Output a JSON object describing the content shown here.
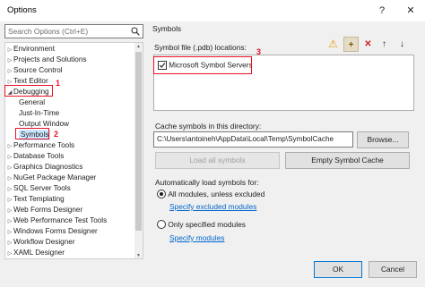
{
  "window": {
    "title": "Options",
    "help_glyph": "?",
    "close_glyph": "✕"
  },
  "search": {
    "placeholder": "Search Options (Ctrl+E)"
  },
  "tree": {
    "items": [
      {
        "label": "Environment",
        "expander": "▷"
      },
      {
        "label": "Projects and Solutions",
        "expander": "▷"
      },
      {
        "label": "Source Control",
        "expander": "▷"
      },
      {
        "label": "Text Editor",
        "expander": "▷"
      },
      {
        "label": "Debugging",
        "expander": "◢"
      },
      {
        "label": "General",
        "expander": ""
      },
      {
        "label": "Just-In-Time",
        "expander": ""
      },
      {
        "label": "Output Window",
        "expander": ""
      },
      {
        "label": "Symbols",
        "expander": ""
      },
      {
        "label": "Performance Tools",
        "expander": "▷"
      },
      {
        "label": "Database Tools",
        "expander": "▷"
      },
      {
        "label": "Graphics Diagnostics",
        "expander": "▷"
      },
      {
        "label": "NuGet Package Manager",
        "expander": "▷"
      },
      {
        "label": "SQL Server Tools",
        "expander": "▷"
      },
      {
        "label": "Text Templating",
        "expander": "▷"
      },
      {
        "label": "Web Forms Designer",
        "expander": "▷"
      },
      {
        "label": "Web Performance Test Tools",
        "expander": "▷"
      },
      {
        "label": "Windows Forms Designer",
        "expander": "▷"
      },
      {
        "label": "Workflow Designer",
        "expander": "▷"
      },
      {
        "label": "XAML Designer",
        "expander": "▷"
      }
    ]
  },
  "callouts": {
    "c1": "1",
    "c2": "2",
    "c3": "3"
  },
  "symbols": {
    "group_title": "Symbols",
    "locations_label": "Symbol file (.pdb) locations:",
    "toolbar": {
      "warning": "⚠",
      "add": "+",
      "remove": "✕",
      "up": "↑",
      "down": "↓"
    },
    "locations": [
      {
        "label": "Microsoft Symbol Servers",
        "checked": true
      }
    ],
    "cache_label": "Cache symbols in this directory:",
    "cache_path": "C:\\Users\\antoineh\\AppData\\Local\\Temp\\SymbolCache",
    "browse_label": "Browse...",
    "load_all_label": "Load all symbols",
    "empty_cache_label": "Empty Symbol Cache",
    "auto_load_label": "Automatically load symbols for:",
    "radio_all": "All modules, unless excluded",
    "link_excluded": "Specify excluded modules",
    "radio_only": "Only specified modules",
    "link_specify": "Specify modules"
  },
  "footer": {
    "ok_label": "OK",
    "cancel_label": "Cancel"
  },
  "colors": {
    "accent": "#0078d7",
    "callout_red": "#e81123",
    "link": "#0066cc"
  }
}
